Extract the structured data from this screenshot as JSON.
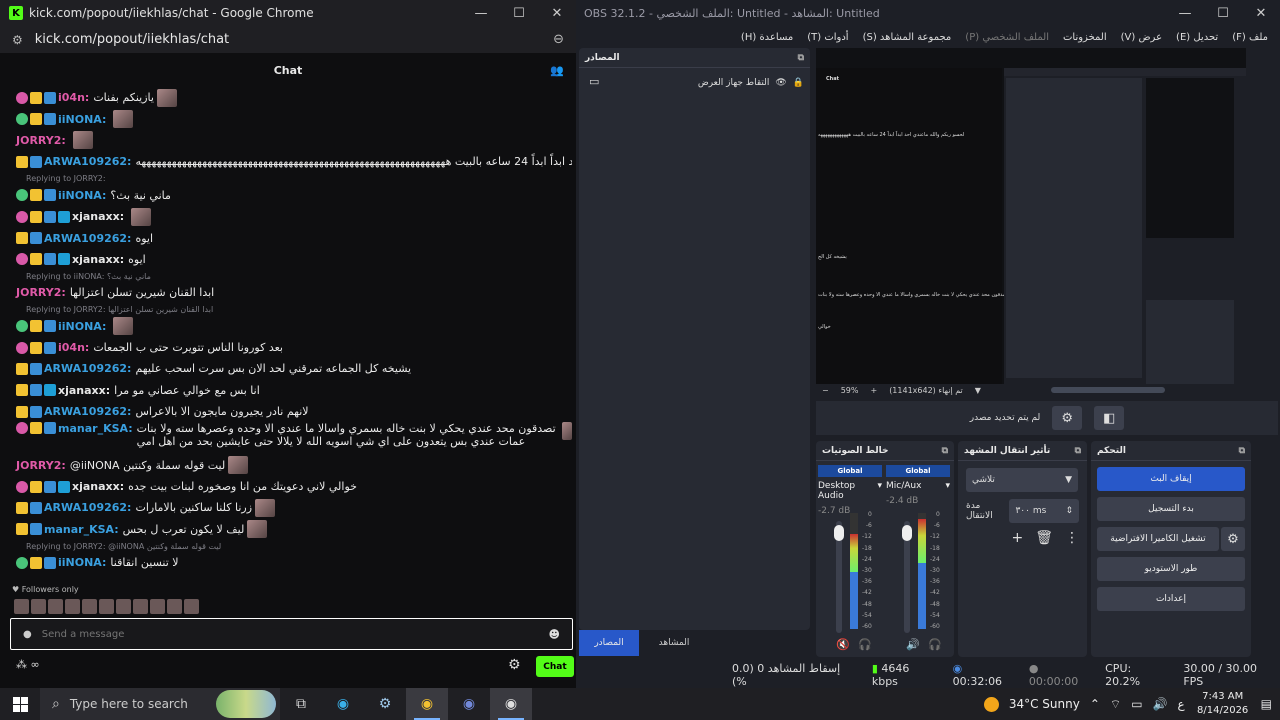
{
  "chrome": {
    "title": "kick.com/popout/iiekhlas/chat - Google Chrome",
    "url": "kick.com/popout/iiekhlas/chat",
    "chat_header": "Chat",
    "followers_only": "Followers only",
    "input_placeholder": "Send a message",
    "chat_button": "Chat"
  },
  "messages": [
    {
      "user": "i04n:",
      "color": "#e05aa8",
      "text": "يازينكم بفنات",
      "badges": [
        "sub",
        "crown",
        "ver"
      ],
      "emote": true
    },
    {
      "user": "iiNONA:",
      "color": "#3aa0e0",
      "text": "",
      "badges": [
        "gift",
        "crown",
        "ver"
      ],
      "emote": true
    },
    {
      "user": "JORRY2:",
      "color": "#e05aa8",
      "text": "",
      "badges": [],
      "emote": true
    },
    {
      "user": "ARWA109262:",
      "color": "#3aa0e0",
      "text": "لحسو ريكم والله ماعندي احد ابداً ابداً 24 ساعه بالبيت هههههههههههههههههههههههههههههههههههههههههههههههههههههههههههههه",
      "badges": [
        "crown",
        "ver"
      ],
      "emote": false
    },
    {
      "reply": "Replying to JORRY2:"
    },
    {
      "user": "iiNONA:",
      "color": "#3aa0e0",
      "text": "ماني نية بث؟",
      "badges": [
        "gift",
        "crown",
        "ver"
      ],
      "emote": false
    },
    {
      "user": "xjanaxx:",
      "color": "#e8e8e8",
      "text": "",
      "badges": [
        "sub",
        "crown",
        "ver",
        "og"
      ],
      "emote": true
    },
    {
      "user": "ARWA109262:",
      "color": "#3aa0e0",
      "text": "ايوه",
      "badges": [
        "crown",
        "ver"
      ],
      "emote": false
    },
    {
      "user": "xjanaxx:",
      "color": "#e8e8e8",
      "text": "ايوه",
      "badges": [
        "sub",
        "crown",
        "ver",
        "og"
      ],
      "emote": false
    },
    {
      "reply": "Replying to iiNONA: ماني نية بث؟"
    },
    {
      "user": "JORRY2:",
      "color": "#e05aa8",
      "text": "ابدا القنان شيرين تسلن اعتزالها",
      "badges": [],
      "emote": false
    },
    {
      "reply": "Replying to JORRY2: ابدا القنان شيرين تسلن اعتزالها"
    },
    {
      "user": "iiNONA:",
      "color": "#3aa0e0",
      "text": "",
      "badges": [
        "gift",
        "crown",
        "ver"
      ],
      "emote": true
    },
    {
      "user": "i04n:",
      "color": "#e05aa8",
      "text": "بعد كورونا الناس تتويرت حتى ب الجمعات",
      "badges": [
        "sub",
        "crown",
        "ver"
      ],
      "emote": false
    },
    {
      "user": "ARWA109262:",
      "color": "#3aa0e0",
      "text": "يشيخه كل الجماعه تمرقني لحد الان بس سرت اسحب عليهم",
      "badges": [
        "crown",
        "ver"
      ],
      "emote": false
    },
    {
      "user": "xjanaxx:",
      "color": "#e8e8e8",
      "text": "انا بس مع خوالي عصاني مو مرا",
      "badges": [
        "crown",
        "ver",
        "og"
      ],
      "emote": false
    },
    {
      "user": "ARWA109262:",
      "color": "#3aa0e0",
      "text": "لانهم نادر يجيرون مايجون الا بالاعراس",
      "badges": [
        "crown",
        "ver"
      ],
      "emote": false
    },
    {
      "user": "manar_KSA:",
      "color": "#3aa0e0",
      "text": "تصدقون محد عندي يحكي لا بنت خاله بسمري واسالا ما عندي الا وحده وعصرها سته ولا بنات عمات عندي بس يتعدون على اي شي اسويه الله لا يلالا حتى عايشين بحد من اهل امي",
      "badges": [
        "sub",
        "crown",
        "ver"
      ],
      "emote": true,
      "tall": true
    },
    {
      "user": "JORRY2:",
      "color": "#e05aa8",
      "text": "@iiNONA ليت قوله سملة وكنتين",
      "badges": [],
      "emote": true
    },
    {
      "user": "xjanaxx:",
      "color": "#e8e8e8",
      "text": "خوالي لاني دعويتك من انا وصخوره لبنات بيت جده",
      "badges": [
        "sub",
        "crown",
        "ver",
        "og"
      ],
      "emote": false
    },
    {
      "user": "ARWA109262:",
      "color": "#3aa0e0",
      "text": "زرنا كلنا ساكنين بالامارات",
      "badges": [
        "crown",
        "ver"
      ],
      "emote": true
    },
    {
      "user": "manar_KSA:",
      "color": "#3aa0e0",
      "text": "ليف لا يكون تعرب ل بحس",
      "badges": [
        "crown",
        "ver"
      ],
      "emote": true
    },
    {
      "reply": "Replying to JORRY2: @iiNONA ليت قوله سملة وكنتين"
    },
    {
      "user": "iiNONA:",
      "color": "#3aa0e0",
      "text": "لا تنسين انقاقنا",
      "badges": [
        "gift",
        "crown",
        "ver"
      ],
      "emote": false
    }
  ],
  "obs": {
    "title": "OBS 32.1.2 - الملف الشخصي: Untitled - المشاهد: Untitled",
    "menu": [
      "ملف (F)",
      "تحديل (E)",
      "عرض (V)",
      "المخزونات",
      "الملف الشخصي (P)",
      "مجموعة المشاهد (S)",
      "أدوات (T)",
      "مساعدة (H)"
    ],
    "sources_title": "المصادر",
    "source_item": "التقاط جهاز العرض",
    "zoom": "59%",
    "resolution": "(1141x642) تم إنهاء",
    "no_source": "لم يتم تحديد مصدر",
    "mixer_title": "خالط الصوتيات",
    "global_label": "Global",
    "channel1": "Desktop Audio",
    "channel1_db": "-2.7 dB",
    "channel2": "Mic/Aux",
    "channel2_db": "-2.4 dB",
    "scale": [
      "0",
      "-6",
      "-12",
      "-18",
      "-24",
      "-30",
      "-36",
      "-42",
      "-48",
      "-54",
      "-60"
    ],
    "trans_title": "تأثير انتقال المشهد",
    "trans_value": "تلاشي",
    "trans_dur_label": "مدة الانتقال",
    "trans_dur": "٣٠٠ ms",
    "controls_title": "التحكم",
    "ctrl_stream": "إيقاف البث",
    "ctrl_record": "بدء التسجيل",
    "ctrl_vcam": "تشغيل الكاميرا الافتراضية",
    "ctrl_studio": "طور الاستوديو",
    "ctrl_settings": "إعدادات",
    "tab_sources": "المصادر",
    "tab_scenes": "المشاهد",
    "status_dropped": "إسقاط المشاهد 0 (0.0 %)",
    "status_kbps": "4646 kbps",
    "status_time": "00:32:06",
    "status_rec": "00:00:00",
    "status_cpu": "CPU: 20.2%",
    "status_fps": "30.00 / 30.00 FPS"
  },
  "preview_texts": [
    "Chat",
    "لحسو ريكم والله ماعندي احد ابداً ابداً 24 ساعه بالبيت هههههههههههههه",
    "يشيخه كل الج",
    "تصدقون محد عندي يحكي لا بنت خاله بسمري واسالا ما عندي الا وحده وعصرها سته ولا بنات",
    "خوالي"
  ],
  "taskbar": {
    "search": "Type here to search",
    "weather": "34°C  Sunny",
    "lang": "ع",
    "time": "7:43 AM",
    "date": "8/14/2026"
  },
  "colors": {
    "kick_green": "#53fc18",
    "obs_bg": "#1d1f26",
    "stream_blue": "#2858c9"
  }
}
